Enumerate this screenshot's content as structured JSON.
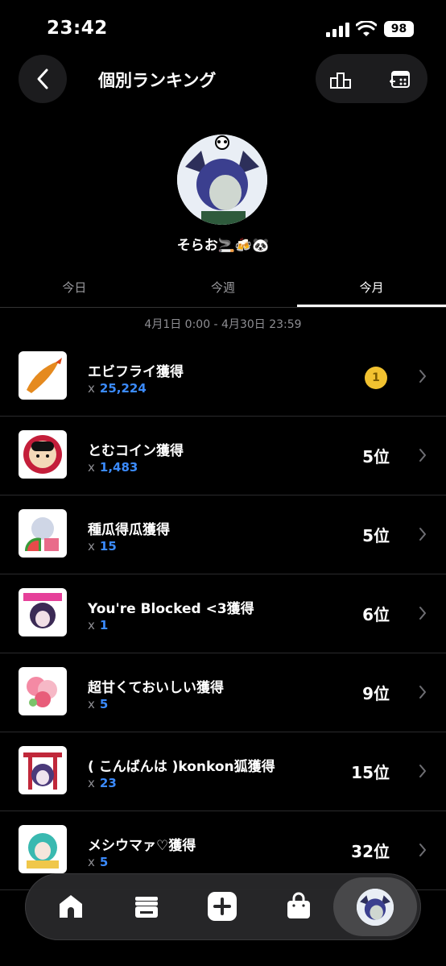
{
  "status_bar": {
    "time": "23:42",
    "battery": "98"
  },
  "header": {
    "title": "個別ランキング"
  },
  "profile": {
    "username": "そらお🚬🍻🐼"
  },
  "tabs": [
    {
      "label": "今日",
      "active": false
    },
    {
      "label": "今週",
      "active": false
    },
    {
      "label": "今月",
      "active": true
    }
  ],
  "date_range": "4月1日 0:00 - 4月30日 23:59",
  "rankings": [
    {
      "name": "エビフライ獲得",
      "count_prefix": "x",
      "count": "25,224",
      "rank": "1",
      "medal": true,
      "thumb": "fried-shrimp-icon"
    },
    {
      "name": "とむコイン獲得",
      "count_prefix": "x",
      "count": "1,483",
      "rank": "5位",
      "medal": false,
      "thumb": "coin-icon"
    },
    {
      "name": "種瓜得瓜獲得",
      "count_prefix": "x",
      "count": "15",
      "rank": "5位",
      "medal": false,
      "thumb": "watermelon-sticker-icon"
    },
    {
      "name": "You're Blocked <3獲得",
      "count_prefix": "x",
      "count": "1",
      "rank": "6位",
      "medal": false,
      "thumb": "blocked-sticker-icon"
    },
    {
      "name": "超甘くておいしい獲得",
      "count_prefix": "x",
      "count": "5",
      "rank": "9位",
      "medal": false,
      "thumb": "sweets-sticker-icon"
    },
    {
      "name": "( こんばんは )konkon狐獲得",
      "count_prefix": "x",
      "count": "23",
      "rank": "15位",
      "medal": false,
      "thumb": "fox-sticker-icon"
    },
    {
      "name": "メシウマァ♡獲得",
      "count_prefix": "x",
      "count": "5",
      "rank": "32位",
      "medal": false,
      "thumb": "meshiuma-sticker-icon"
    }
  ],
  "colors": {
    "accent": "#3b8bff",
    "medal": "#f2c230",
    "background": "#000000"
  }
}
